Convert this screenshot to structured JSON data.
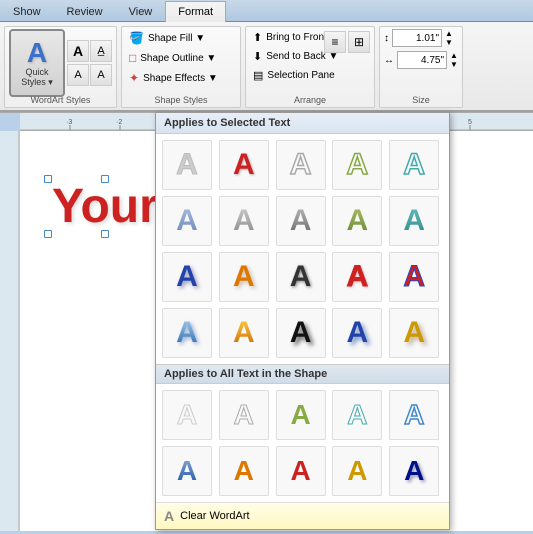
{
  "tabs": [
    {
      "label": "Show",
      "active": false
    },
    {
      "label": "Review",
      "active": false
    },
    {
      "label": "View",
      "active": false
    },
    {
      "label": "Format",
      "active": true
    }
  ],
  "ribbon": {
    "wordart_group": {
      "quick_styles_label": "Quick\nStyles",
      "dropdown_arrow": "▼",
      "a_label": "A"
    },
    "shape_group": {
      "items": [
        {
          "label": "Shape Fill ▼",
          "name": "shape-fill"
        },
        {
          "label": "Shape Outline ▼",
          "name": "shape-outline"
        },
        {
          "label": "Shape Effects ▼",
          "name": "shape-effects"
        }
      ],
      "expand_icon": "⬜"
    },
    "arrange_group": {
      "items": [
        {
          "label": "Bring to Front ▼",
          "name": "bring-to-front"
        },
        {
          "label": "Send to Back ▼",
          "name": "send-to-back"
        },
        {
          "label": "Selection Pane",
          "name": "selection-pane"
        }
      ]
    },
    "align_group": {
      "buttons": [
        "≡",
        "⊞"
      ]
    },
    "size_group": {
      "height_label": "1.01\"",
      "width_label": "4.75\""
    }
  },
  "dropdown": {
    "section1_header": "Applies to Selected Text",
    "section2_header": "Applies to All Text in the Shape",
    "clear_label": "Clear WordArt",
    "items_row1": [
      {
        "style": "plain-white",
        "label": "A"
      },
      {
        "style": "red",
        "label": "A"
      },
      {
        "style": "outline-gray",
        "label": "A"
      },
      {
        "style": "outline-green",
        "label": "A"
      },
      {
        "style": "outline-teal",
        "label": "A"
      }
    ],
    "items_row2": [
      {
        "style": "grad-blue-light",
        "label": "A"
      },
      {
        "style": "grad-gray",
        "label": "A"
      },
      {
        "style": "grad-gray2",
        "label": "A"
      },
      {
        "style": "grad-green",
        "label": "A"
      },
      {
        "style": "grad-teal",
        "label": "A"
      }
    ],
    "items_row3": [
      {
        "style": "solid-blue",
        "label": "A"
      },
      {
        "style": "solid-orange",
        "label": "A"
      },
      {
        "style": "solid-gray",
        "label": "A"
      },
      {
        "style": "solid-red-outline",
        "label": "A"
      },
      {
        "style": "solid-red-blue",
        "label": "A"
      }
    ],
    "items_row4": [
      {
        "style": "shadow-blue",
        "label": "A"
      },
      {
        "style": "shadow-orange",
        "label": "A"
      },
      {
        "style": "shadow-dark",
        "label": "A"
      },
      {
        "style": "shadow-blue2",
        "label": "A"
      },
      {
        "style": "shadow-gold",
        "label": "A"
      }
    ],
    "items_row5": [
      {
        "style": "plain-gray-sm",
        "label": "A"
      },
      {
        "style": "plain-gray2-sm",
        "label": "A"
      },
      {
        "style": "plain-green-sm",
        "label": "A"
      },
      {
        "style": "plain-teal-sm",
        "label": "A"
      },
      {
        "style": "plain-blue-sm",
        "label": "A"
      }
    ],
    "items_row6": [
      {
        "style": "blue-sm2",
        "label": "A"
      },
      {
        "style": "orange-sm",
        "label": "A"
      },
      {
        "style": "red-sm",
        "label": "A"
      },
      {
        "style": "gold-sm",
        "label": "A"
      },
      {
        "style": "blue-dark-sm",
        "label": "A"
      }
    ]
  },
  "canvas": {
    "wordart_text": "Your"
  },
  "size": {
    "height": "1.01\"",
    "width": "4.75\""
  }
}
